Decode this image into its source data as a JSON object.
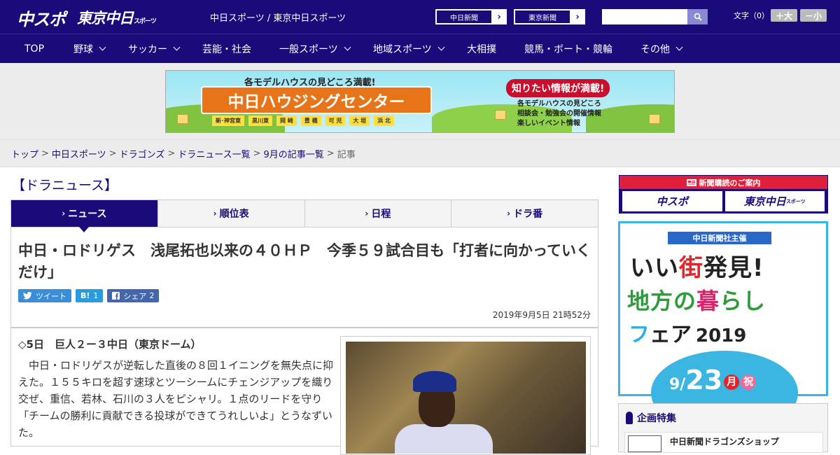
{
  "header": {
    "logo_main": "中スポ",
    "logo_tokyo": "東京中日",
    "logo_tokyo_suffix": "スポーツ",
    "site_title": "中日スポーツ / 東京中日スポーツ",
    "ext_link_1": "中日新聞",
    "ext_link_2": "東京新聞",
    "search_placeholder": "",
    "font_size_label": "文字（0）",
    "font_plus": "＋大",
    "font_minus": "－小"
  },
  "nav": {
    "items": [
      {
        "label": "TOP",
        "dropdown": false
      },
      {
        "label": "野球",
        "dropdown": true
      },
      {
        "label": "サッカー",
        "dropdown": true
      },
      {
        "label": "芸能・社会",
        "dropdown": false
      },
      {
        "label": "一般スポーツ",
        "dropdown": true
      },
      {
        "label": "地域スポーツ",
        "dropdown": true
      },
      {
        "label": "大相撲",
        "dropdown": false
      },
      {
        "label": "競馬・ボート・競輪",
        "dropdown": false
      },
      {
        "label": "その他",
        "dropdown": true
      }
    ]
  },
  "ad_banner": {
    "top_text": "各モデルハウスの見どころ満載!",
    "main_text": "中日ハウジングセンター",
    "towns": [
      "新･神宮東",
      "黒川東",
      "岡 崎",
      "豊 橋",
      "可 児",
      "大 垣",
      "浜 北"
    ],
    "right_title": "知りたい情報が満載!",
    "right_lines": [
      "各モデルハウスの見どころ",
      "相談会・勉強会の開催情報",
      "楽しいイベント情報"
    ]
  },
  "breadcrumb": {
    "items": [
      "トップ",
      "中日スポーツ",
      "ドラゴンズ",
      "ドラニュース一覧",
      "9月の記事一覧"
    ],
    "current": "記事"
  },
  "section_title": "【ドラニュース】",
  "tabs": [
    {
      "label": "ニュース",
      "active": true
    },
    {
      "label": "順位表",
      "active": false
    },
    {
      "label": "日程",
      "active": false
    },
    {
      "label": "ドラ番",
      "active": false
    }
  ],
  "article": {
    "headline": "中日・ロドリゲス　浅尾拓也以来の４０ＨＰ　今季５９試合目も「打者に向かっていくだけ」",
    "share": {
      "tweet": "ツイート",
      "hatena_icon": "B!",
      "hatena_count": "1",
      "facebook_label": "シェア",
      "facebook_count": "2"
    },
    "date": "2019年9月5日 21時52分",
    "game_line": "◇5日　巨人２ー３中日（東京ドーム）",
    "body": "中日・ロドリゲスが逆転した直後の８回１イニングを無失点に抑えた。１５５キロを超す速球とツーシームにチェンジアップを織り交ぜ、重信、若林、石川の３人をピシャリ。１点のリードを守り「チームの勝利に貢献できる投球ができてうれしいよ」とうなずいた。"
  },
  "sidebar": {
    "subscribe_header": "新聞購読のご案内",
    "subscribe_logo_1": "中スポ",
    "subscribe_logo_2": "東京中日",
    "subscribe_logo_2_suffix": "スポーツ",
    "ad": {
      "pill": "中日新聞社主催",
      "line1_a": "いい",
      "line1_b": "街",
      "line1_c": "発見!",
      "line2_a": "地方の",
      "line2_b": "暮",
      "line2_c": "らし",
      "line3_a": "フ",
      "line3_b": "ェア",
      "line3_year": "2019",
      "date_month": "9/",
      "date_day": "23",
      "date_weekday": "月",
      "date_holiday": "祝"
    },
    "feature_title": "企画特集",
    "feature_item": "中日新聞ドラゴンズショップ"
  },
  "colors": {
    "brand_navy": "#1a0a7a",
    "accent_red": "#e0203a",
    "ad_blue": "#3bb5e2"
  }
}
